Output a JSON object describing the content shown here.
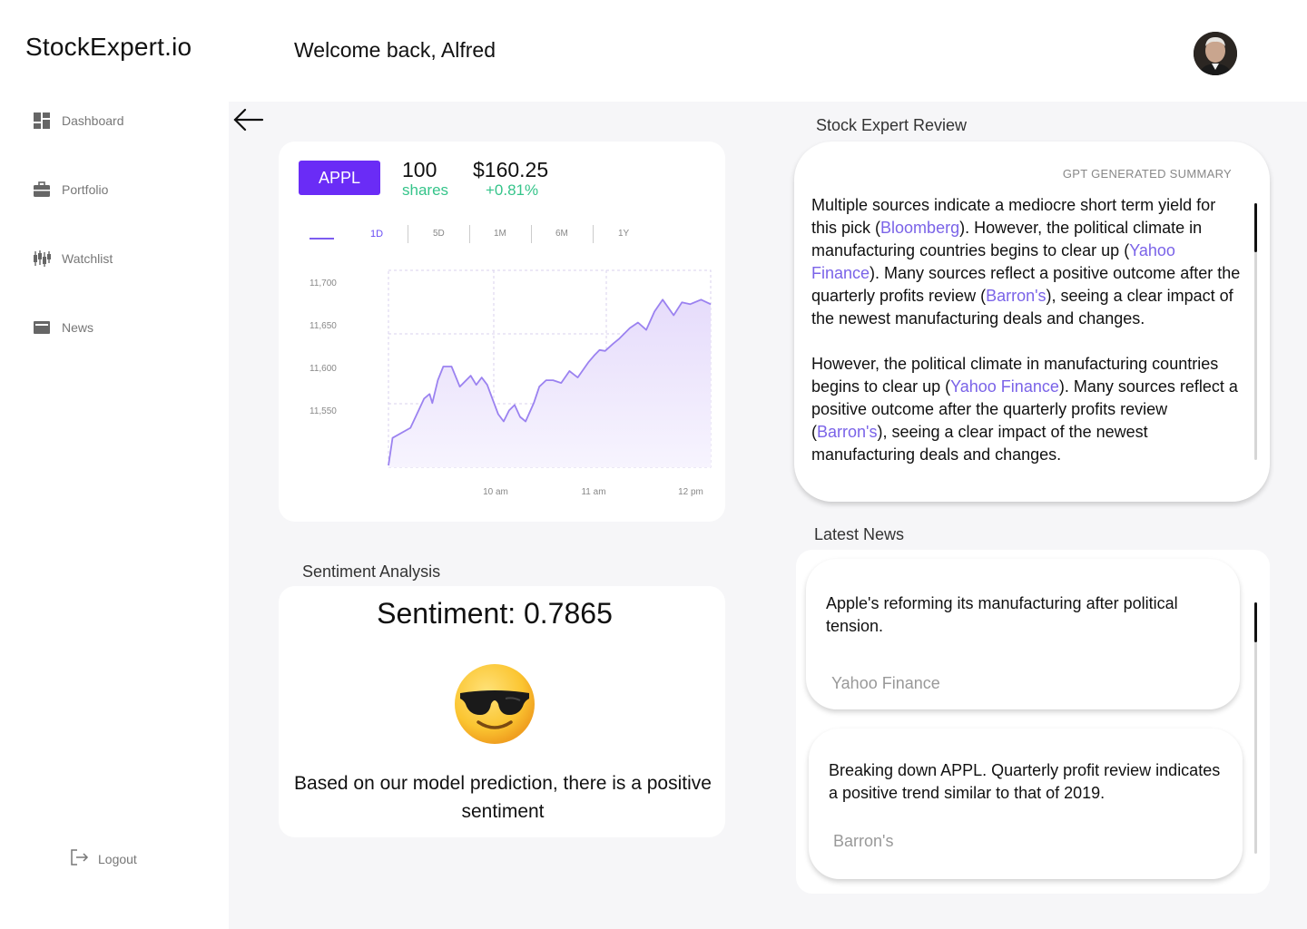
{
  "app": {
    "brand": "StockExpert.io",
    "welcome": "Welcome back, Alfred"
  },
  "sidebar": {
    "items": [
      {
        "label": "Dashboard",
        "icon": "dashboard-icon"
      },
      {
        "label": "Portfolio",
        "icon": "briefcase-icon"
      },
      {
        "label": "Watchlist",
        "icon": "candlestick-icon"
      },
      {
        "label": "News",
        "icon": "newspaper-icon"
      }
    ],
    "logout": "Logout"
  },
  "stock": {
    "ticker": "APPL",
    "shares": "100",
    "shares_label": "shares",
    "price": "$160.25",
    "change": "+0.81%",
    "ranges": [
      "1D",
      "5D",
      "1M",
      "6M",
      "1Y"
    ],
    "active_range": "1D"
  },
  "chart_data": {
    "type": "area",
    "title": "",
    "xlabel": "",
    "ylabel": "",
    "y_ticks": [
      "11,700",
      "11,650",
      "11,600",
      "11,550"
    ],
    "x_ticks": [
      "10 am",
      "11 am",
      "12 pm"
    ],
    "ylim": [
      11510,
      11725
    ],
    "x": [
      0,
      3,
      16,
      22,
      26,
      30,
      32,
      36,
      40,
      46,
      52,
      60,
      64,
      68,
      72,
      76,
      80,
      84,
      88,
      92,
      96,
      100,
      106,
      110,
      115,
      120,
      126,
      132,
      138,
      146,
      150,
      154,
      158,
      164,
      168,
      176,
      182,
      188,
      194,
      200,
      208,
      214,
      220,
      228,
      235
    ],
    "y": [
      11512,
      11542,
      11553,
      11572,
      11585,
      11590,
      11580,
      11605,
      11620,
      11620,
      11598,
      11610,
      11600,
      11608,
      11600,
      11584,
      11568,
      11560,
      11572,
      11578,
      11565,
      11560,
      11580,
      11598,
      11605,
      11605,
      11602,
      11615,
      11608,
      11625,
      11632,
      11638,
      11637,
      11645,
      11650,
      11662,
      11668,
      11660,
      11680,
      11693,
      11676,
      11690,
      11688,
      11693,
      11688
    ],
    "grid": true,
    "colors": {
      "line": "#9b82f0",
      "fill_top": "#e6dcfb",
      "fill_bottom": "#f7f4fe",
      "grid": "#d8d0ee"
    }
  },
  "sentiment": {
    "section_title": "Sentiment Analysis",
    "value_text": "Sentiment: 0.7865",
    "emoji": "sunglasses-emoji",
    "description": "Based on our model prediction, there is a positive sentiment"
  },
  "review": {
    "section_title": "Stock Expert Review",
    "label": "GPT GENERATED SUMMARY",
    "p1": [
      {
        "text": "Multiple sources indicate a mediocre short term yield for this pick ("
      },
      {
        "link": "Bloomberg"
      },
      {
        "text": "). However, the political climate in manufacturing countries begins to clear up ("
      },
      {
        "link": "Yahoo Finance"
      },
      {
        "text": "). Many sources reflect a positive outcome after the quarterly profits review ("
      },
      {
        "link": "Barron's"
      },
      {
        "text": "), seeing a clear impact of the newest manufacturing deals and changes."
      }
    ],
    "p2": [
      {
        "text": "However, the political climate in manufacturing countries begins to clear up ("
      },
      {
        "link": "Yahoo Finance"
      },
      {
        "text": "). Many sources reflect a positive outcome after the quarterly profits review ("
      },
      {
        "link": "Barron's"
      },
      {
        "text": "), seeing a clear impact of the newest manufacturing deals and changes."
      }
    ]
  },
  "news": {
    "section_title": "Latest News",
    "items": [
      {
        "headline": "Apple's reforming its manufacturing after political tension.",
        "source": "Yahoo Finance"
      },
      {
        "headline": "Breaking down APPL. Quarterly profit review indicates a positive trend similar to that of 2019.",
        "source": "Barron's"
      }
    ]
  },
  "colors": {
    "accent": "#6a2cf6",
    "positive": "#35c48a",
    "link": "#7a63e8",
    "background": "#f6f6f8"
  }
}
